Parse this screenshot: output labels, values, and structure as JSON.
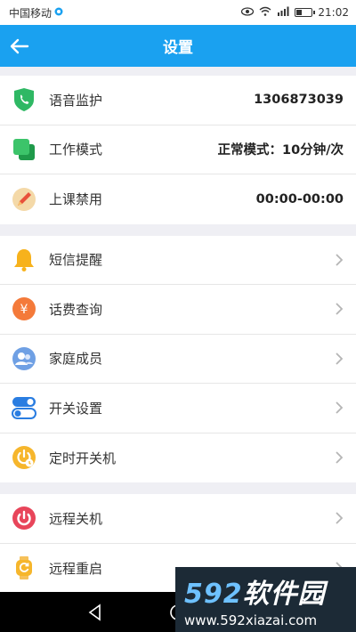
{
  "status_bar": {
    "carrier": "中国移动",
    "time": "21:02"
  },
  "header": {
    "title": "设置"
  },
  "groups": [
    {
      "items": [
        {
          "label": "语音监护",
          "value": "1306873039",
          "icon": "phone-shield-icon"
        },
        {
          "label": "工作模式",
          "value": "正常模式：10分钟/次",
          "icon": "work-mode-icon"
        },
        {
          "label": "上课禁用",
          "value": "00:00-00:00",
          "icon": "pencil-icon"
        }
      ]
    },
    {
      "items": [
        {
          "label": "短信提醒",
          "icon": "bell-icon"
        },
        {
          "label": "话费查询",
          "icon": "yuan-icon"
        },
        {
          "label": "家庭成员",
          "icon": "family-icon"
        },
        {
          "label": "开关设置",
          "icon": "toggle-icon"
        },
        {
          "label": "定时开关机",
          "icon": "timer-power-icon"
        }
      ]
    },
    {
      "items": [
        {
          "label": "远程关机",
          "icon": "power-icon"
        },
        {
          "label": "远程重启",
          "icon": "restart-watch-icon"
        }
      ]
    }
  ],
  "watermark": {
    "brand_num": "592",
    "brand_text": "软件园",
    "url": "www.592xiazai.com"
  },
  "colors": {
    "app_bar": "#1aa1f0",
    "phone_shield": "#2fb864",
    "bell": "#f7b21c",
    "yuan": "#f47a3a",
    "family": "#6fa0e4",
    "toggle": "#2a7de1",
    "timer": "#f6b62c",
    "power": "#e8455a"
  }
}
